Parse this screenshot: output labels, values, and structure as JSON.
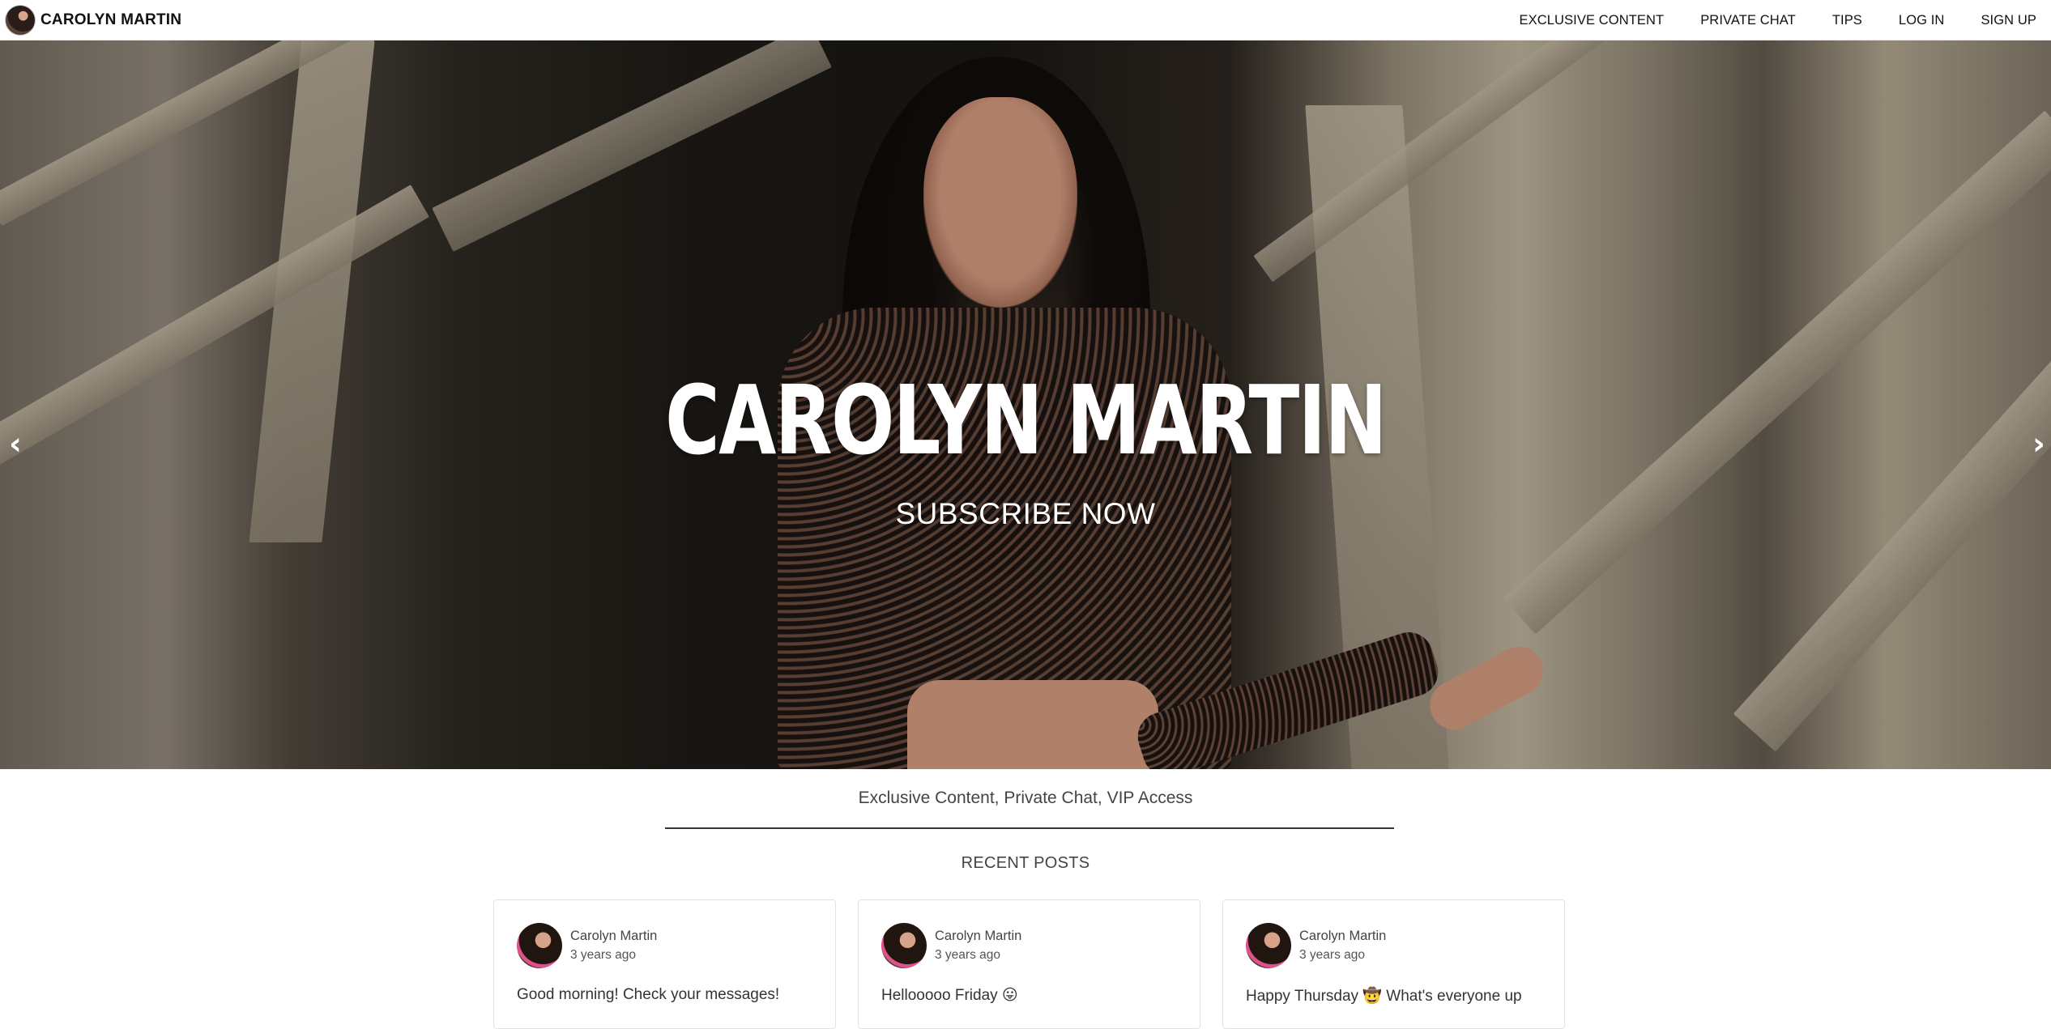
{
  "brand": {
    "name": "CAROLYN MARTIN"
  },
  "nav": {
    "items": [
      {
        "label": "EXCLUSIVE CONTENT"
      },
      {
        "label": "PRIVATE CHAT"
      },
      {
        "label": "TIPS"
      },
      {
        "label": "LOG IN"
      },
      {
        "label": "SIGN UP"
      }
    ]
  },
  "hero": {
    "title": "CAROLYN MARTIN",
    "cta": "SUBSCRIBE NOW",
    "prev_icon": "chevron-left-icon",
    "next_icon": "chevron-right-icon"
  },
  "tagline": "Exclusive Content, Private Chat, VIP Access",
  "recent_posts": {
    "title": "RECENT POSTS",
    "items": [
      {
        "author": "Carolyn Martin",
        "time": "3 years ago",
        "text": "Good morning! Check your messages!"
      },
      {
        "author": "Carolyn Martin",
        "time": "3 years ago",
        "text": "Hellooooo Friday 😛"
      },
      {
        "author": "Carolyn Martin",
        "time": "3 years ago",
        "text": "Happy Thursday 🤠 What's everyone up"
      }
    ]
  }
}
